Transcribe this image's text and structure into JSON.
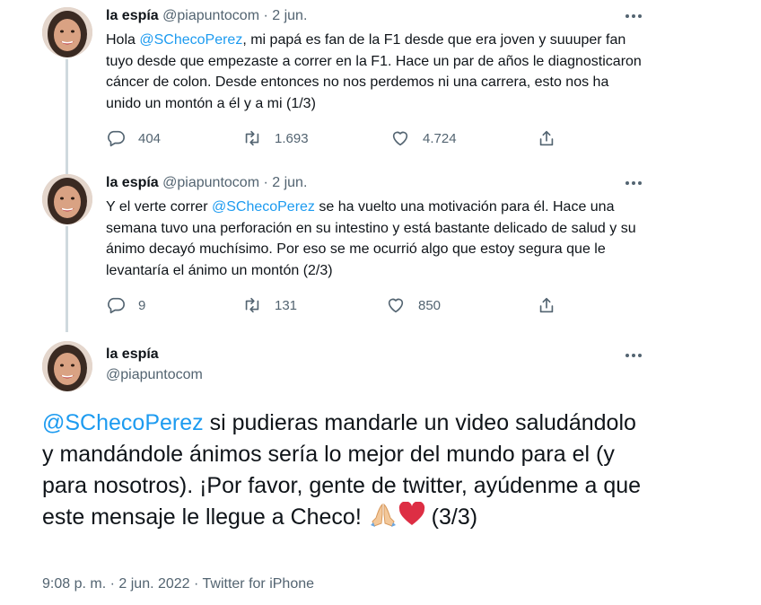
{
  "colors": {
    "link": "#1d9bf0",
    "secondary": "#536471",
    "text": "#0f1419",
    "thread_line": "#cfd9de"
  },
  "tweets": [
    {
      "name": "la espía",
      "handle": "@piapuntocom",
      "sep": "·",
      "date": "2 jun.",
      "text_before": "Hola ",
      "mention": "@SChecoPerez",
      "text_after": ", mi papá es fan de la F1 desde que era joven y suuuper fan tuyo desde que empezaste a correr en la F1. Hace un par de años le diagnosticaron cáncer de colon. Desde entonces no nos perdemos ni una carrera, esto nos ha unido un montón a él y a mi (1/3)",
      "replies": "404",
      "retweets": "1.693",
      "likes": "4.724"
    },
    {
      "name": "la espía",
      "handle": "@piapuntocom",
      "sep": "·",
      "date": "2 jun.",
      "text_before": "Y el verte correr ",
      "mention": "@SChecoPerez",
      "text_after": " se ha vuelto una motivación para él. Hace una semana tuvo una perforación en su intestino y está bastante delicado de salud y su ánimo decayó muchísimo. Por eso se me ocurrió algo que estoy segura que le levantaría el ánimo un montón (2/3)",
      "replies": "9",
      "retweets": "131",
      "likes": "850"
    }
  ],
  "main": {
    "name": "la espía",
    "handle": "@piapuntocom",
    "mention": "@SChecoPerez",
    "text": " si pudieras mandarle un video saludándolo y mandándole ánimos sería lo mejor del mundo para el (y para nosotros). ¡Por favor, gente de twitter, ayúdenme a que este mensaje le llegue a Checo! ",
    "suffix": " (3/3)",
    "time": "9:08 p. m.",
    "sep": "·",
    "full_date": "2 jun. 2022",
    "source": "Twitter for iPhone"
  },
  "icons": [
    "more-icon",
    "reply-icon",
    "retweet-icon",
    "like-icon",
    "share-icon",
    "pray-emoji",
    "heart-emoji"
  ]
}
